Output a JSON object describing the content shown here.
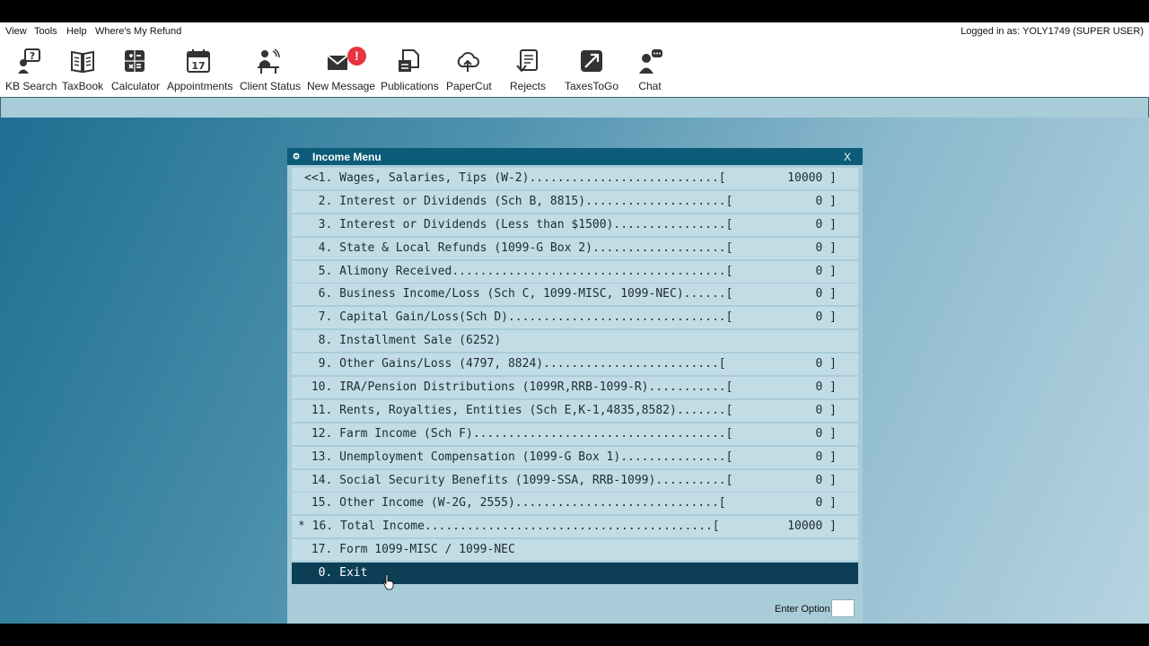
{
  "menubar": {
    "items": [
      "View",
      "Tools",
      "Help",
      "Where's My Refund"
    ],
    "login_status": "Logged in as: YOLY1749 (SUPER USER)"
  },
  "toolbar": {
    "items": [
      {
        "label": "KB Search",
        "icon": "kb-search-icon"
      },
      {
        "label": "TaxBook",
        "icon": "book-icon"
      },
      {
        "label": "Calculator",
        "icon": "calculator-icon"
      },
      {
        "label": "Appointments",
        "icon": "calendar-icon"
      },
      {
        "label": "Client Status",
        "icon": "client-status-icon"
      },
      {
        "label": "New Message",
        "icon": "envelope-icon",
        "badge": "!"
      },
      {
        "label": "Publications",
        "icon": "publications-icon"
      },
      {
        "label": "PaperCut",
        "icon": "cloud-icon"
      },
      {
        "label": "Rejects",
        "icon": "rejects-icon"
      },
      {
        "label": "TaxesToGo",
        "icon": "taxestogo-icon"
      },
      {
        "label": "Chat",
        "icon": "chat-icon"
      }
    ]
  },
  "window": {
    "title": "Income Menu",
    "close_label": "X",
    "rows": [
      {
        "text": "<<1. Wages, Salaries, Tips (W-2)...........................[",
        "value": "10000 ]"
      },
      {
        "text": "  2. Interest or Dividends (Sch B, 8815)....................[",
        "value": "0 ]"
      },
      {
        "text": "  3. Interest or Dividends (Less than $1500)................[",
        "value": "0 ]"
      },
      {
        "text": "  4. State & Local Refunds (1099-G Box 2)...................[",
        "value": "0 ]"
      },
      {
        "text": "  5. Alimony Received.......................................[",
        "value": "0 ]"
      },
      {
        "text": "  6. Business Income/Loss (Sch C, 1099-MISC, 1099-NEC)......[",
        "value": "0 ]"
      },
      {
        "text": "  7. Capital Gain/Loss(Sch D)...............................[",
        "value": "0 ]"
      },
      {
        "text": "  8. Installment Sale (6252)",
        "value": ""
      },
      {
        "text": "  9. Other Gains/Loss (4797, 8824).........................[",
        "value": "0 ]"
      },
      {
        "text": " 10. IRA/Pension Distributions (1099R,RRB-1099-R)...........[",
        "value": "0 ]"
      },
      {
        "text": " 11. Rents, Royalties, Entities (Sch E,K-1,4835,8582).......[",
        "value": "0 ]"
      },
      {
        "text": " 12. Farm Income (Sch F)....................................[",
        "value": "0 ]"
      },
      {
        "text": " 13. Unemployment Compensation (1099-G Box 1)...............[",
        "value": "0 ]"
      },
      {
        "text": " 14. Social Security Benefits (1099-SSA, RRB-1099)..........[",
        "value": "0 ]"
      },
      {
        "text": " 15. Other Income (W-2G, 2555).............................[",
        "value": "0 ]"
      },
      {
        "text": "* 16. Total Income.........................................[",
        "value": "10000 ]"
      },
      {
        "text": " 17. Form 1099-MISC / 1099-NEC",
        "value": ""
      },
      {
        "text": "  0. Exit",
        "value": "",
        "selected": true
      }
    ],
    "enter_option_label": "Enter Option:",
    "enter_option_value": ""
  },
  "colors": {
    "titlebar": "#0c5b79",
    "selected_row": "#0c3f55",
    "row_bg": "#c2dce6",
    "badge": "#e8343f"
  }
}
